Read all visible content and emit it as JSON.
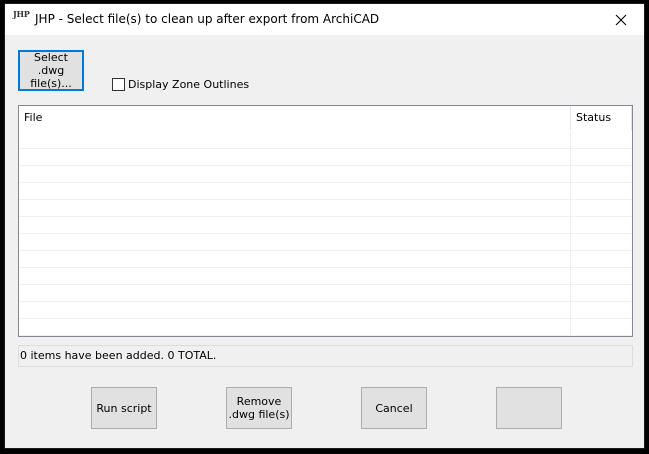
{
  "window": {
    "title": "JHP - Select file(s) to clean up after export from ArchiCAD",
    "app_icon_text": "JHP",
    "close_symbol": "✕"
  },
  "top": {
    "select_button_label": "Select .dwg\nfile(s)...",
    "checkbox_label": "Display Zone Outlines",
    "checkbox_checked": false
  },
  "list": {
    "columns": [
      "File",
      "Status"
    ],
    "rows": []
  },
  "status": {
    "text": "0 items have been added.  0 TOTAL."
  },
  "buttons": {
    "run_label": "Run script",
    "remove_label": "Remove\n.dwg file(s)",
    "cancel_label": "Cancel",
    "blank_label": ""
  },
  "colors": {
    "focus_border": "#0078d7",
    "button_face": "#e1e1e1",
    "window_bg": "#f0f0f0"
  }
}
